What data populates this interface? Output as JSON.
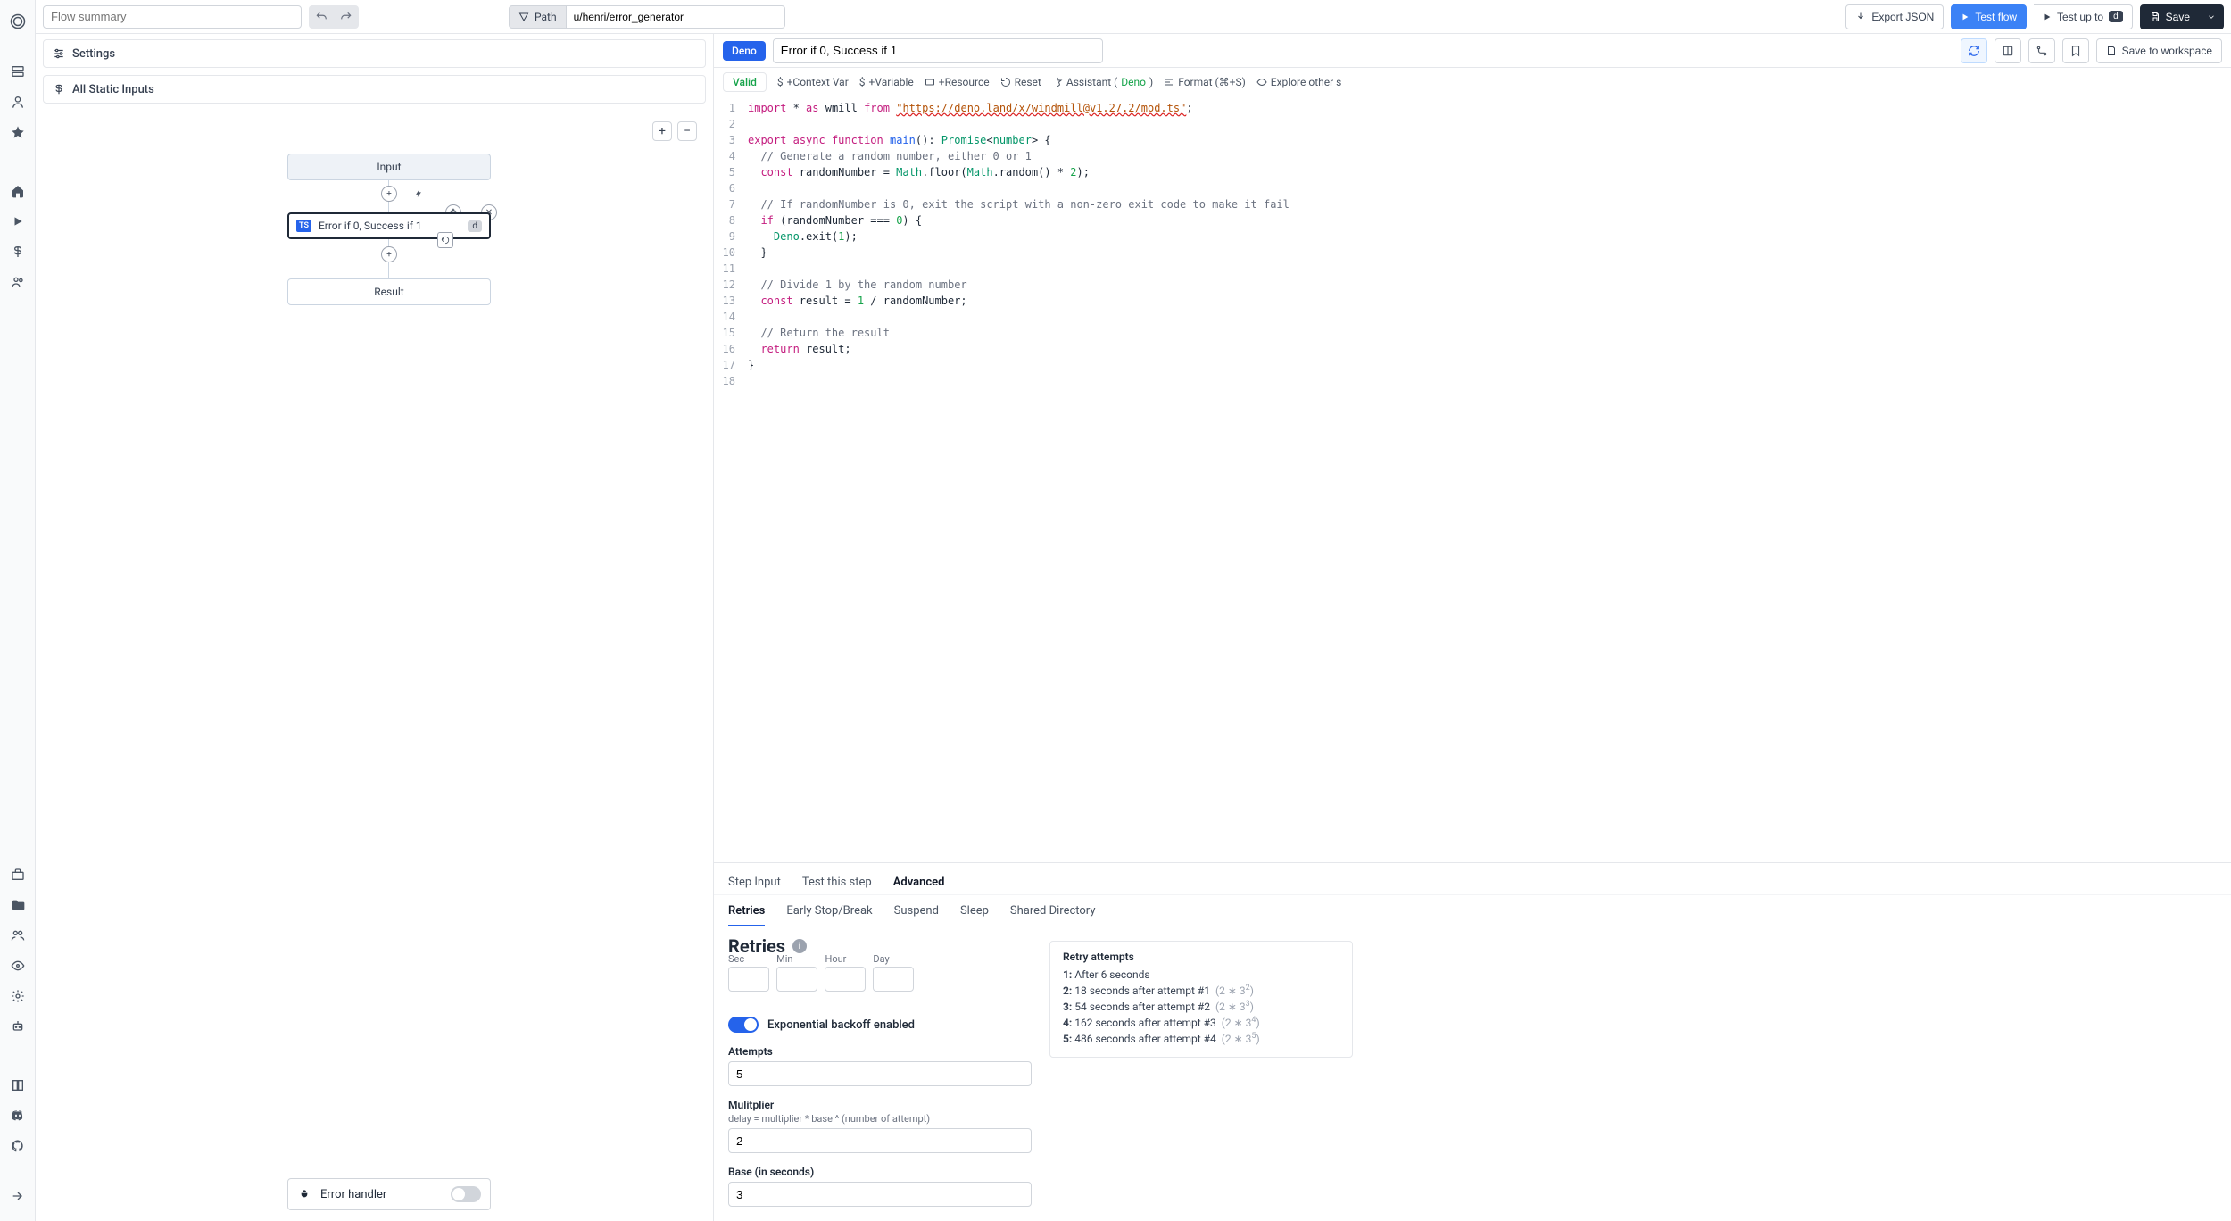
{
  "topbar": {
    "summary_placeholder": "Flow summary",
    "path_label": "Path",
    "path_value": "u/henri/error_generator",
    "export_json": "Export JSON",
    "test_flow": "Test flow",
    "test_up_to": "Test up to",
    "test_up_to_key": "d",
    "save": "Save"
  },
  "left": {
    "settings": "Settings",
    "all_static_inputs": "All Static Inputs",
    "node_input": "Input",
    "node_step": "Error if 0, Success if 1",
    "node_step_key": "d",
    "node_result": "Result",
    "error_handler": "Error handler"
  },
  "right": {
    "lang_badge": "Deno",
    "step_name": "Error if 0, Success if 1",
    "save_workspace": "Save to workspace",
    "toolbar": {
      "valid": "Valid",
      "context_var": "+Context Var",
      "variable": "+Variable",
      "resource": "+Resource",
      "reset": "Reset",
      "assistant_prefix": "Assistant (",
      "assistant_lang": "Deno",
      "assistant_suffix": ")",
      "format": "Format (⌘+S)",
      "explore": "Explore other s"
    },
    "tabs": {
      "step_input": "Step Input",
      "test_step": "Test this step",
      "advanced": "Advanced"
    },
    "subtabs": {
      "retries": "Retries",
      "early_stop": "Early Stop/Break",
      "suspend": "Suspend",
      "sleep": "Sleep",
      "shared_dir": "Shared Directory"
    }
  },
  "code_lines": [
    1,
    2,
    3,
    4,
    5,
    6,
    7,
    8,
    9,
    10,
    11,
    12,
    13,
    14,
    15,
    16,
    17,
    18
  ],
  "retries": {
    "title": "Retries",
    "units": {
      "sec": "Sec",
      "min": "Min",
      "hour": "Hour",
      "day": "Day"
    },
    "exp_label": "Exponential backoff enabled",
    "attempts_label": "Attempts",
    "attempts_value": "5",
    "multiplier_label": "Mulitplier",
    "multiplier_help": "delay = multiplier * base ^ (number of attempt)",
    "multiplier_value": "2",
    "base_label": "Base (in seconds)",
    "base_value": "3",
    "right_title": "Retry attempts",
    "attempts": [
      {
        "idx": "1:",
        "text": "After 6 seconds",
        "formula": ""
      },
      {
        "idx": "2:",
        "text": "18 seconds after attempt #1",
        "formula": "(2 ∗ 3",
        "exp": "2",
        "close": ")"
      },
      {
        "idx": "3:",
        "text": "54 seconds after attempt #2",
        "formula": "(2 ∗ 3",
        "exp": "3",
        "close": ")"
      },
      {
        "idx": "4:",
        "text": "162 seconds after attempt #3",
        "formula": "(2 ∗ 3",
        "exp": "4",
        "close": ")"
      },
      {
        "idx": "5:",
        "text": "486 seconds after attempt #4",
        "formula": "(2 ∗ 3",
        "exp": "5",
        "close": ")"
      }
    ]
  }
}
